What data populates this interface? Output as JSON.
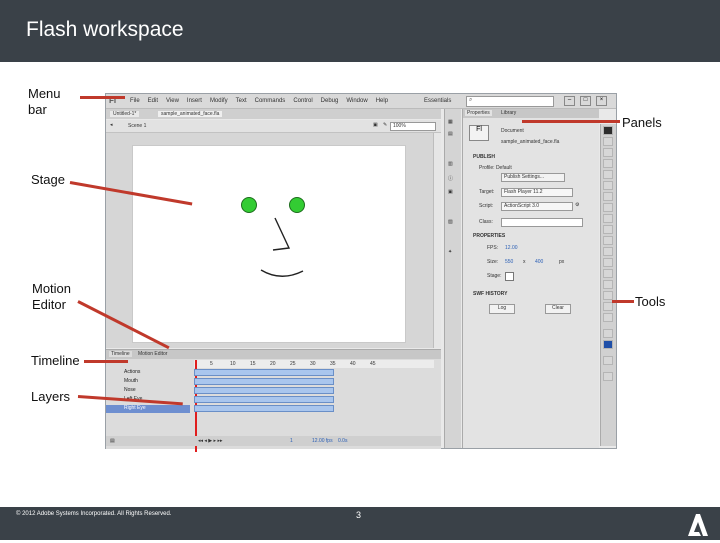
{
  "slide": {
    "title": "Flash workspace",
    "footer_copyright": "© 2012 Adobe Systems Incorporated. All Rights Reserved.",
    "page_number": "3"
  },
  "callouts": {
    "menu_bar": "Menu bar",
    "panels": "Panels",
    "stage": "Stage",
    "motion_editor": "Motion Editor",
    "tools": "Tools",
    "timeline": "Timeline",
    "layers": "Layers"
  },
  "flash_ui": {
    "menu": [
      "File",
      "Edit",
      "View",
      "Insert",
      "Modify",
      "Text",
      "Commands",
      "Control",
      "Debug",
      "Window",
      "Help"
    ],
    "workspace": "Essentials",
    "doc_tabs": [
      "Untitled-1*",
      "sample_animated_face.fla"
    ],
    "scene": "Scene 1",
    "zoom": "100%",
    "panel_tabs": [
      "Properties",
      "Library"
    ],
    "properties": {
      "type": "Document",
      "file_name": "sample_animated_face.fla",
      "publish_header": "PUBLISH",
      "profile": "Profile: Default",
      "publish_settings": "Publish Settings...",
      "target_label": "Target:",
      "target_value": "Flash Player 11.2",
      "script_label": "Script:",
      "script_value": "ActionScript 3.0",
      "class_label": "Class:",
      "properties_header": "PROPERTIES",
      "fps_label": "FPS:",
      "fps_value": "12.00",
      "size_label": "Size:",
      "size_w": "550",
      "size_x": "x",
      "size_h": "400",
      "size_unit": "px",
      "stage_label": "Stage:",
      "swf_history_header": "SWF HISTORY",
      "log_button": "Log",
      "clear_button": "Clear"
    },
    "timeline_tabs": [
      "Timeline",
      "Motion Editor"
    ],
    "layers": [
      "Actions",
      "Mouth",
      "Nose",
      "Left Eye",
      "Right Eye"
    ],
    "frame_numbers": [
      "5",
      "10",
      "15",
      "20",
      "25",
      "30",
      "35",
      "40",
      "45"
    ],
    "timeline_status": [
      "1",
      "12.00 fps",
      "0.0s"
    ],
    "colors": {
      "eye_fill": "#33cc33",
      "frames_fill": "#a9c6ee",
      "callout_line": "#c0392b",
      "slide_bar": "#3a4148"
    }
  }
}
